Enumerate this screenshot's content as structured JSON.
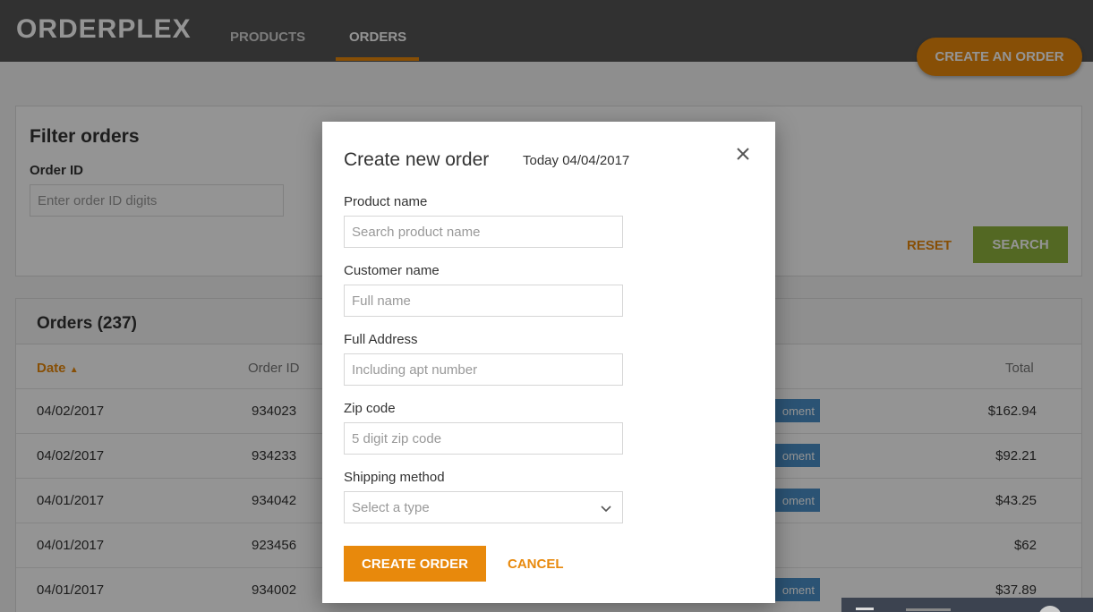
{
  "app": {
    "brand": "ORDERPLEX"
  },
  "nav": {
    "tabs": [
      {
        "label": "PRODUCTS"
      },
      {
        "label": "ORDERS"
      }
    ],
    "active": "ORDERS"
  },
  "header": {
    "create_button": "CREATE AN ORDER"
  },
  "filter": {
    "title": "Filter orders",
    "order_id_label": "Order ID",
    "order_id_placeholder": "Enter order ID digits",
    "reset_label": "RESET",
    "search_label": "SEARCH"
  },
  "orders": {
    "title": "Orders (237)",
    "columns": {
      "date": "Date",
      "order_id": "Order ID",
      "total": "Total"
    },
    "sort_indicator": "▲",
    "rows": [
      {
        "date": "04/02/2017",
        "order_id": "934023",
        "badge": "oment",
        "total": "$162.94"
      },
      {
        "date": "04/02/2017",
        "order_id": "934233",
        "badge": "oment",
        "total": "$92.21"
      },
      {
        "date": "04/01/2017",
        "order_id": "934042",
        "badge": "oment",
        "total": "$43.25"
      },
      {
        "date": "04/01/2017",
        "order_id": "923456",
        "badge": "",
        "total": "$62"
      },
      {
        "date": "04/01/2017",
        "order_id": "934002",
        "badge": "oment",
        "total": "$37.89"
      }
    ]
  },
  "modal": {
    "title": "Create new order",
    "date": "Today 04/04/2017",
    "fields": {
      "product": {
        "label": "Product name",
        "placeholder": "Search product name"
      },
      "customer": {
        "label": "Customer name",
        "placeholder": "Full name"
      },
      "address": {
        "label": "Full Address",
        "placeholder": "Including apt number"
      },
      "zip": {
        "label": "Zip code",
        "placeholder": "5 digit zip code"
      },
      "shipping": {
        "label": "Shipping method",
        "placeholder": "Select a type"
      }
    },
    "create_label": "CREATE ORDER",
    "cancel_label": "CANCEL"
  },
  "colors": {
    "accent": "#e8890c",
    "header_bg": "#555555",
    "search_green": "#8fb33d",
    "badge_blue": "#4a90c8"
  },
  "icons": {
    "close": "close-icon",
    "select_caret": "chevron-down-icon",
    "sort": "sort-asc-icon"
  }
}
